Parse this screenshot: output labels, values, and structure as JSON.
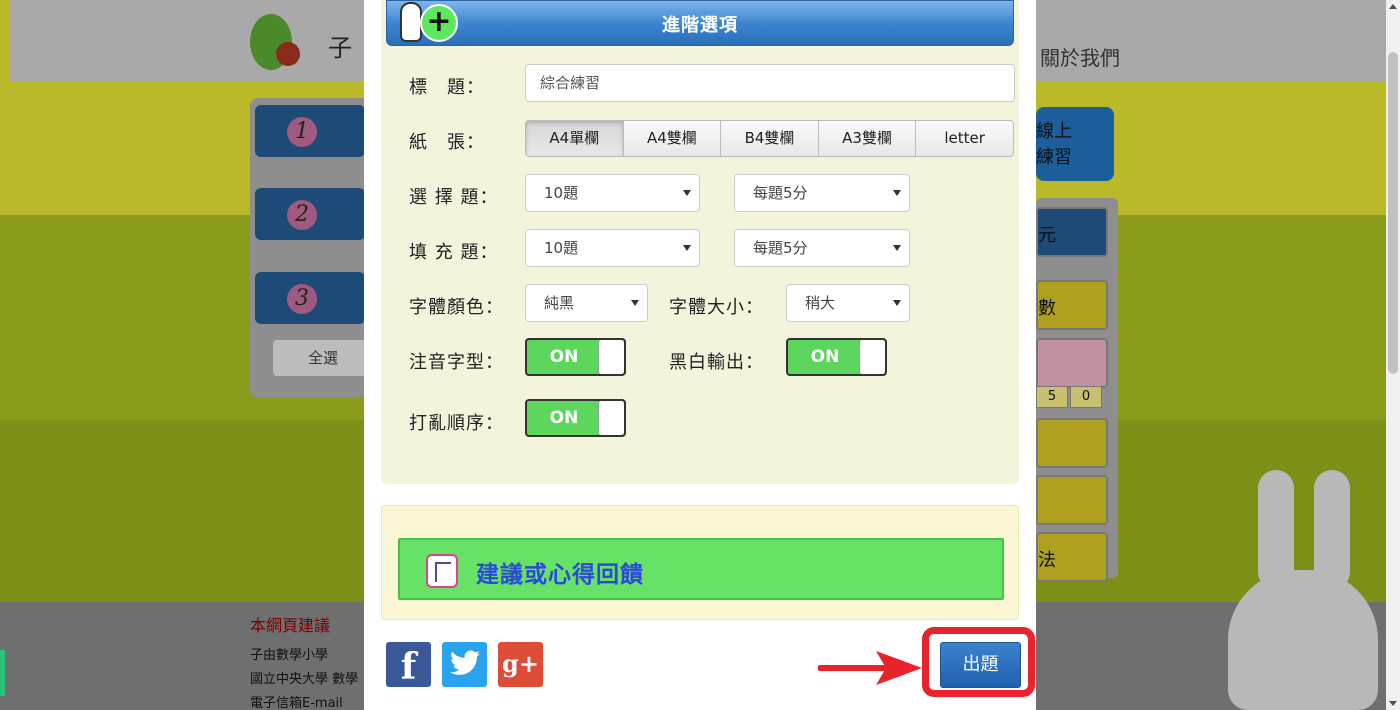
{
  "background": {
    "about_link": "關於我們",
    "logo_text": "子",
    "steps": [
      "1",
      "2",
      "3"
    ],
    "select_all": "全選",
    "right_button": [
      "線上",
      "練習"
    ],
    "right_items": [
      "元",
      "數",
      "",
      "",
      "",
      "法"
    ],
    "scores": [
      "5",
      "0"
    ],
    "footer_lines": [
      "本網頁建議",
      "子由數學小學",
      "國立中央大學 數學",
      "電子信箱E-mail"
    ]
  },
  "panel": {
    "title": "進階選項",
    "title_label": "標　題：",
    "title_value": "綜合練習",
    "paper_label": "紙　張：",
    "paper_options": [
      "A4單欄",
      "A4雙欄",
      "B4雙欄",
      "A3雙欄",
      "letter"
    ],
    "paper_selected": "A4單欄",
    "choice_label": "選 擇 題：",
    "choice_count": "10題",
    "choice_score": "每題5分",
    "fill_label": "填 充 題：",
    "fill_count": "10題",
    "fill_score": "每題5分",
    "font_color_label": "字體顏色：",
    "font_color_value": "純黑",
    "font_size_label": "字體大小：",
    "font_size_value": "稍大",
    "zhuyin_label": "注音字型：",
    "zhuyin_state": "ON",
    "bw_label": "黑白輸出：",
    "bw_state": "ON",
    "shuffle_label": "打亂順序：",
    "shuffle_state": "ON"
  },
  "feedback": {
    "label": "建議或心得回饋"
  },
  "social": {
    "facebook": "f",
    "twitter": "twitter-icon",
    "googleplus": "g+"
  },
  "submit": {
    "label": "出題"
  },
  "colors": {
    "accent_blue": "#2a6fb8",
    "toggle_green": "#5cd65c",
    "highlight_red": "#e8232b",
    "feedback_green": "#66e266"
  }
}
